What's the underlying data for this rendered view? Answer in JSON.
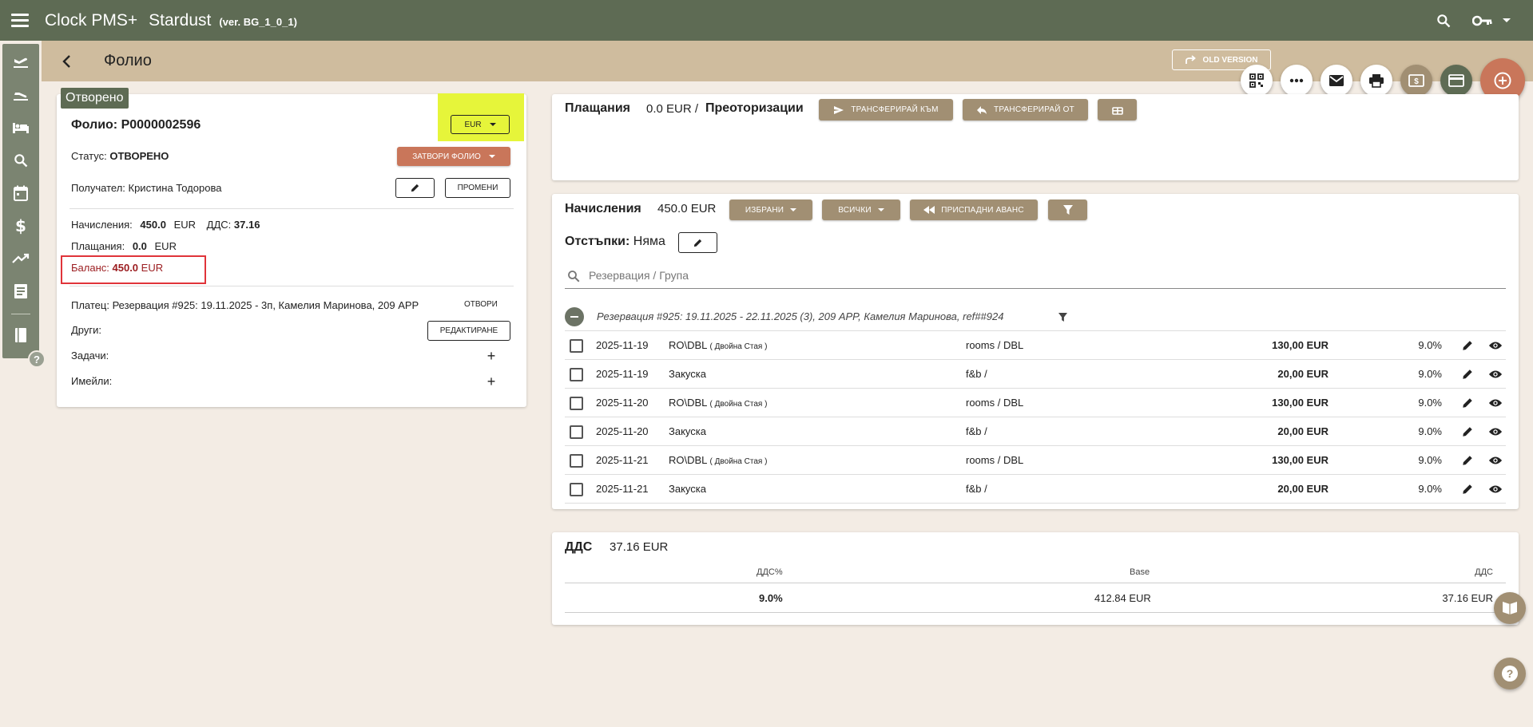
{
  "header": {
    "brand": "Clock PMS+",
    "hotel": "Stardust",
    "version": "(ver. BG_1_0_1)"
  },
  "subheader": {
    "title": "Фолио",
    "old_version": "OLD VERSION"
  },
  "folio": {
    "status_chip": "Отворено",
    "title": "Фолио: P0000002596",
    "currency": "EUR",
    "status_label": "Статус:",
    "status_value": "ОТВОРЕНО",
    "close_button": "ЗАТВОРИ ФОЛИО",
    "recipient": "Получател: Кристина Тодорова",
    "change_button": "ПРОМЕНИ",
    "charges_label": "Начисления:",
    "charges_value": "450.0",
    "charges_currency": "EUR",
    "vat_label": "ДДС:",
    "vat_value": "37.16",
    "payments_label": "Плащания:",
    "payments_value": "0.0",
    "payments_currency": "EUR",
    "balance_label": "Баланс:",
    "balance_value": "450.0",
    "balance_currency": "EUR",
    "payer": "Платец: Резервация #925: 19.11.2025 - 3п, Камелия Маринова, 209 APP",
    "open_link": "ОТВОРИ",
    "others_label": "Други:",
    "edit_button": "РЕДАКТИРАНЕ",
    "tasks_label": "Задачи:",
    "emails_label": "Имейли:"
  },
  "payments": {
    "title": "Плащания",
    "amount": "0.0 EUR /",
    "preauth": "Преоторизации",
    "transfer_to": "ТРАНСФЕРИРАЙ КЪМ",
    "transfer_from": "ТРАНСФЕРИРАЙ ОТ"
  },
  "charges": {
    "title": "Начисления",
    "amount": "450.0 EUR",
    "selected": "ИЗБРАНИ",
    "all": "ВСИЧКИ",
    "deduct_advance": "ПРИСПАДНИ АВАНС",
    "discounts_label": "Отстъпки:",
    "discounts_value": "Няма",
    "search_placeholder": "Резервация / Група",
    "group_label": "Резервация #925: 19.11.2025 - 22.11.2025 (3), 209 APP, Камелия Маринова, ref##924",
    "rows": [
      {
        "date": "2025-11-19",
        "name": "RO\\DBL",
        "sub": "( Двойна Стая )",
        "category": "rooms / DBL",
        "amount": "130,00 EUR",
        "vat": "9.0%"
      },
      {
        "date": "2025-11-19",
        "name": "Закуска",
        "sub": "",
        "category": "f&b /",
        "amount": "20,00 EUR",
        "vat": "9.0%"
      },
      {
        "date": "2025-11-20",
        "name": "RO\\DBL",
        "sub": "( Двойна Стая )",
        "category": "rooms / DBL",
        "amount": "130,00 EUR",
        "vat": "9.0%"
      },
      {
        "date": "2025-11-20",
        "name": "Закуска",
        "sub": "",
        "category": "f&b /",
        "amount": "20,00 EUR",
        "vat": "9.0%"
      },
      {
        "date": "2025-11-21",
        "name": "RO\\DBL",
        "sub": "( Двойна Стая )",
        "category": "rooms / DBL",
        "amount": "130,00 EUR",
        "vat": "9.0%"
      },
      {
        "date": "2025-11-21",
        "name": "Закуска",
        "sub": "",
        "category": "f&b /",
        "amount": "20,00 EUR",
        "vat": "9.0%"
      }
    ]
  },
  "vat": {
    "title": "ДДС",
    "amount": "37.16 EUR",
    "col_rate": "ДДС%",
    "col_base": "Base",
    "col_vat": "ДДС",
    "rate": "9.0%",
    "base": "412.84 EUR",
    "value": "37.16 EUR"
  },
  "icons": {
    "accent_tan": "#a18f73",
    "accent_rust": "#c9765a",
    "topbar": "#5e6b54",
    "subbar": "#cfbc9e",
    "balance_color": "#9b1c1f",
    "highlight": "#e6f53a"
  }
}
